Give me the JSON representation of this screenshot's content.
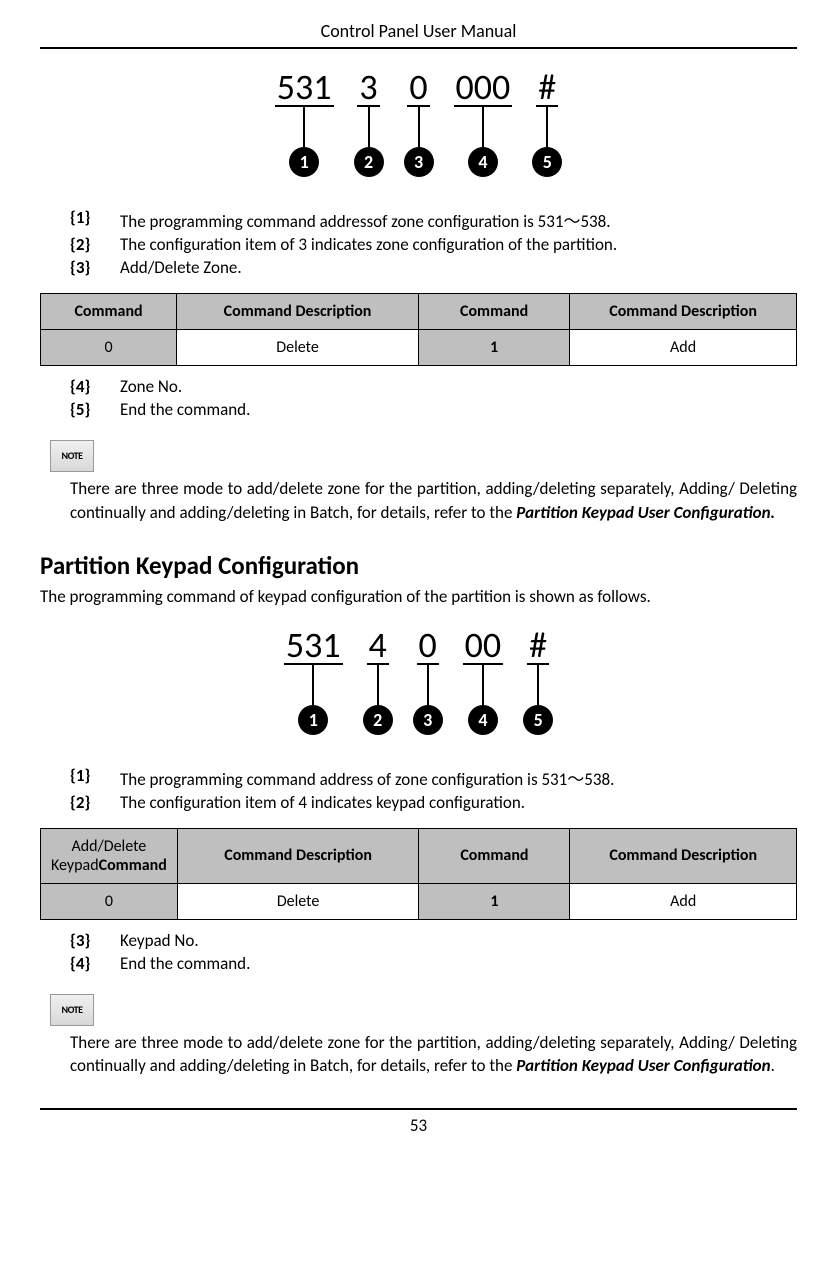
{
  "header": {
    "title": "Control Panel User Manual"
  },
  "diagram1": {
    "parts": [
      {
        "text": "531",
        "num": "1"
      },
      {
        "text": "3",
        "num": "2"
      },
      {
        "text": "0",
        "num": "3"
      },
      {
        "text": "000",
        "num": "4"
      },
      {
        "text": "#",
        "num": "5"
      }
    ]
  },
  "list1": [
    {
      "label": "{1}",
      "desc": "The programming command addressof zone configuration is 531～538."
    },
    {
      "label": "{2}",
      "desc": "The configuration item of 3 indicates zone configuration of the partition."
    },
    {
      "label": "{3}",
      "desc": "Add/Delete Zone."
    }
  ],
  "table1": {
    "headers": [
      "Command",
      "Command Description",
      "Command",
      "Command Description"
    ],
    "row": [
      "0",
      "Delete",
      "1",
      "Add"
    ]
  },
  "list1b": [
    {
      "label": "{4}",
      "desc": "Zone No."
    },
    {
      "label": "{5}",
      "desc": "End the command."
    }
  ],
  "note1": {
    "icon_label": "NOTE",
    "text_pre": "There are three mode to add/delete zone for the partition, adding/deleting separately, Adding/ Deleting continually and adding/deleting in Batch, for details, refer to the ",
    "text_bold": "Partition Keypad User Configuration."
  },
  "section2": {
    "heading": "Partition Keypad Configuration",
    "intro": "The programming command of keypad configuration of the partition is shown as follows."
  },
  "diagram2": {
    "parts": [
      {
        "text": "531",
        "num": "1"
      },
      {
        "text": "4",
        "num": "2"
      },
      {
        "text": "0",
        "num": "3"
      },
      {
        "text": "00",
        "num": "4"
      },
      {
        "text": "#",
        "num": "5"
      }
    ]
  },
  "list2": [
    {
      "label": "{1}",
      "desc": "The programming command address of zone configuration is 531～538."
    },
    {
      "label": "{2}",
      "desc": "The configuration item of 4 indicates keypad configuration."
    }
  ],
  "table2": {
    "header_left_pre": "Add/Delete Keypad",
    "header_left_bold": "Command",
    "headers_rest": [
      "Command Description",
      "Command",
      "Command Description"
    ],
    "row": [
      "0",
      "Delete",
      "1",
      "Add"
    ]
  },
  "list2b": [
    {
      "label": "{3}",
      "desc": "Keypad No."
    },
    {
      "label": "{4}",
      "desc": "End the command."
    }
  ],
  "note2": {
    "icon_label": "NOTE",
    "text_pre": "There are three mode to add/delete zone for the partition, adding/deleting separately, Adding/ Deleting continually and adding/deleting in Batch, for details, refer to the ",
    "text_bold": "Partition Keypad User Configuration",
    "text_post": "."
  },
  "footer": {
    "page": "53"
  }
}
